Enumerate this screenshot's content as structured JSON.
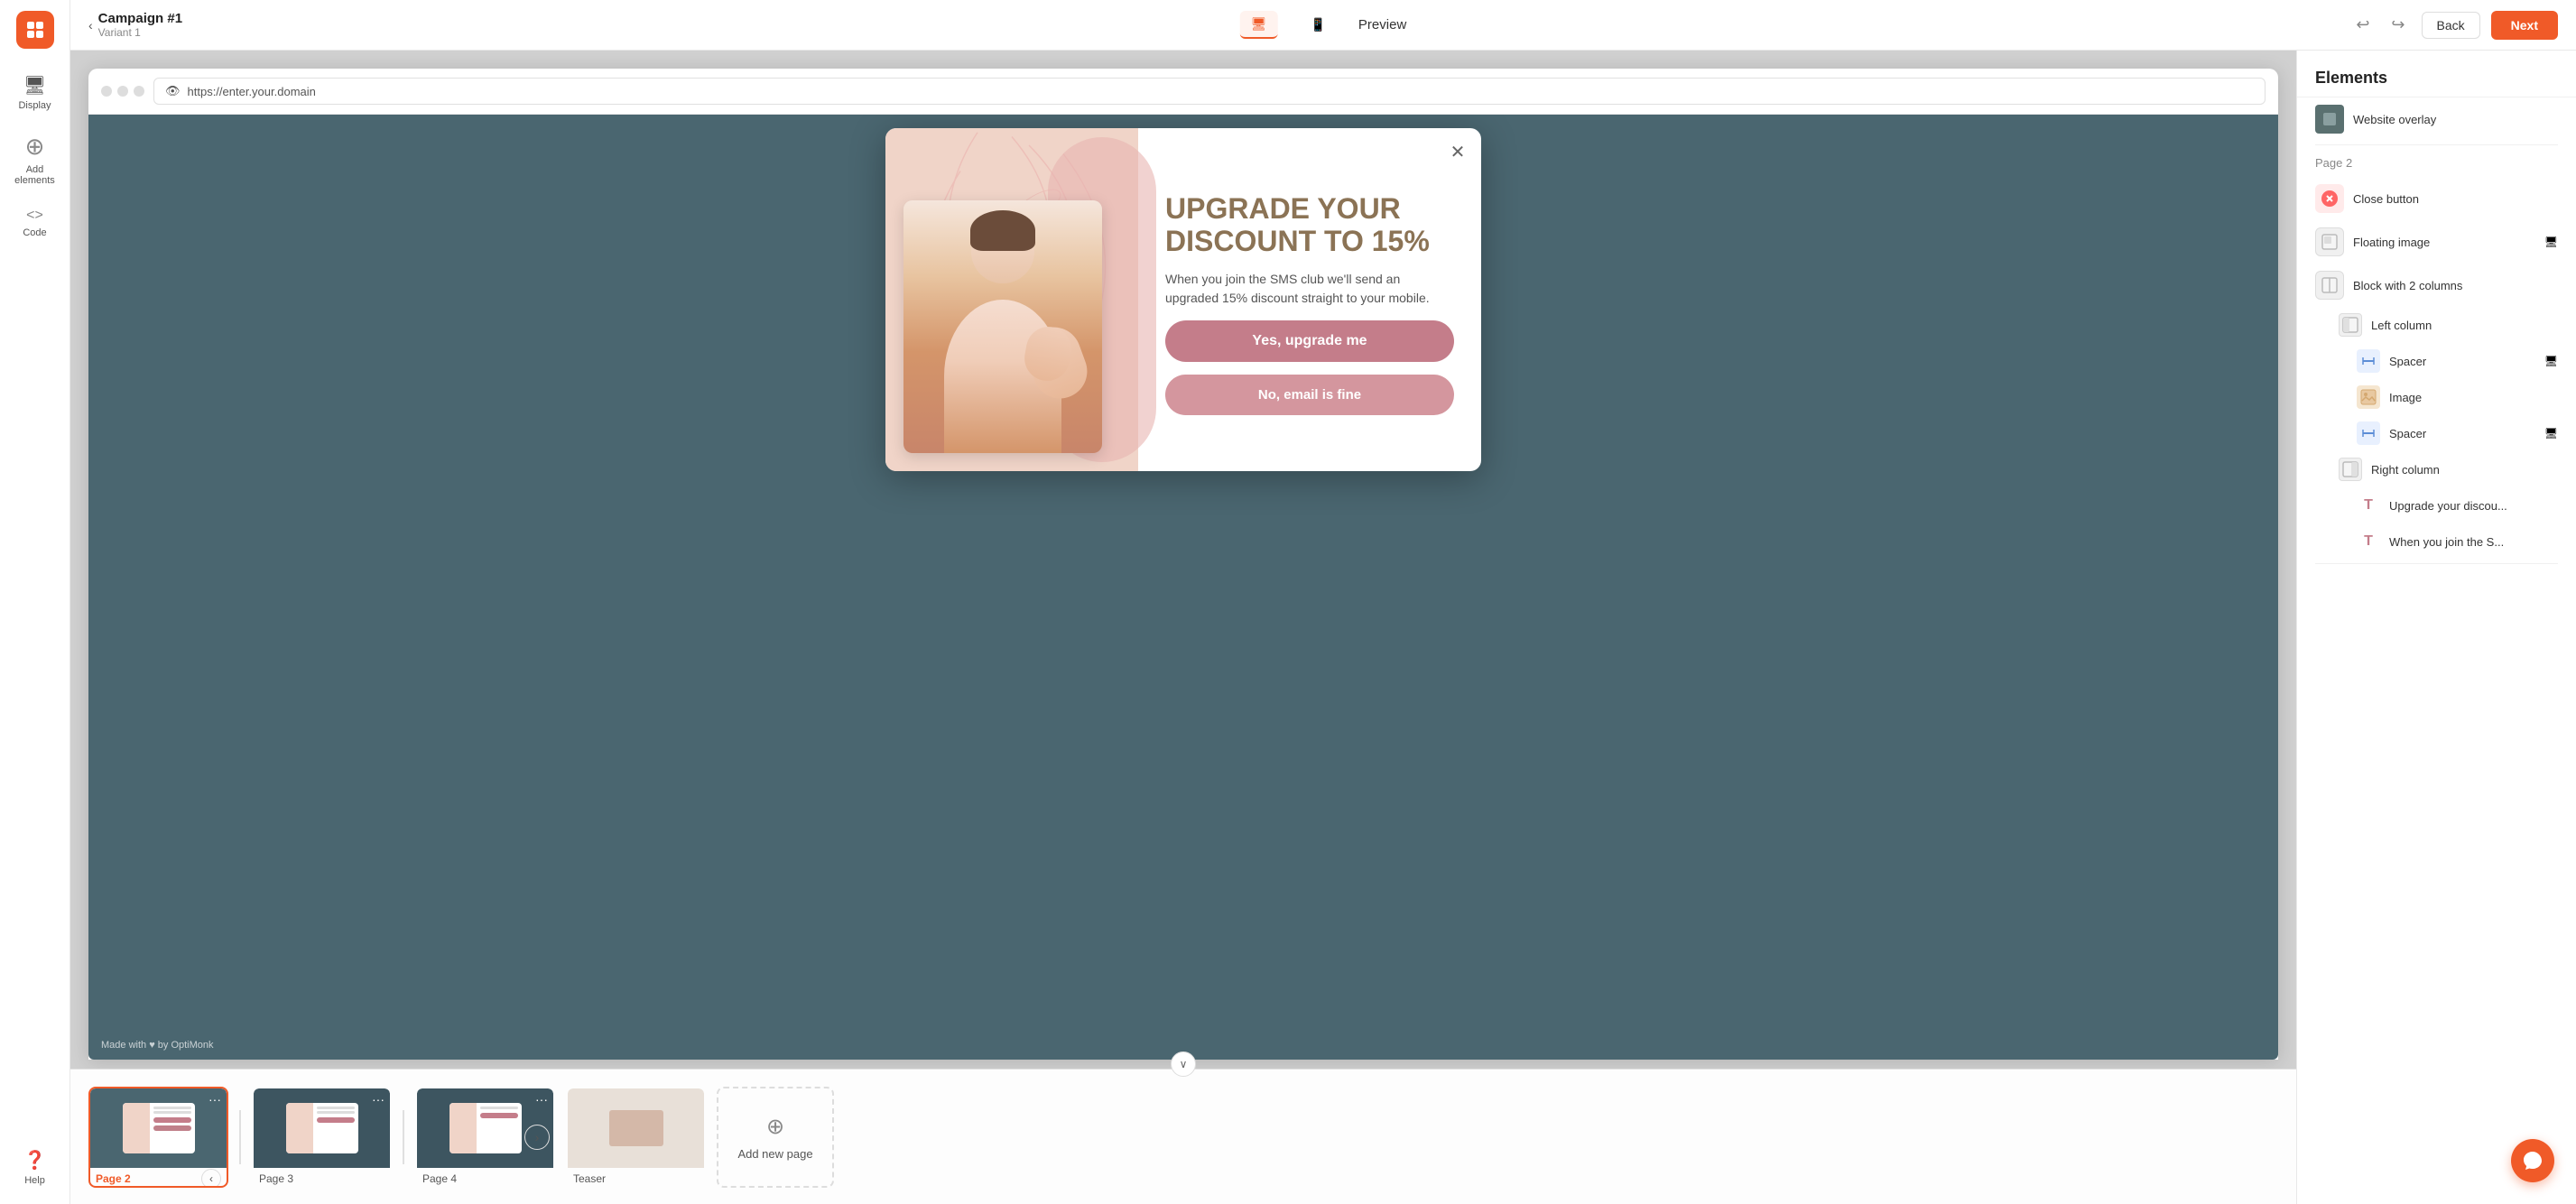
{
  "app": {
    "logo_alt": "OptiMonk logo"
  },
  "header": {
    "back_label": "Back",
    "next_label": "Next",
    "campaign_title": "Campaign #1",
    "campaign_variant": "Variant 1",
    "preview_label": "Preview",
    "url": "https://enter.your.domain",
    "device_desktop_label": "Desktop",
    "device_mobile_label": "Mobile"
  },
  "sidebar": {
    "items": [
      {
        "id": "display",
        "label": "Display",
        "icon": "🖥"
      },
      {
        "id": "add-elements",
        "label": "Add elements",
        "icon": "+"
      },
      {
        "id": "code",
        "label": "Code",
        "icon": "<>"
      },
      {
        "id": "help",
        "label": "Help",
        "icon": "?"
      }
    ]
  },
  "popup": {
    "heading": "UPGRADE YOUR DISCOUNT TO 15%",
    "body": "When you join the SMS club we'll send an upgraded 15% discount straight to your mobile.",
    "btn_yes": "Yes, upgrade me",
    "btn_no": "No, email is fine",
    "watermark": "Made with ♥ by OptiMonk"
  },
  "pages": {
    "page2_label": "Page 2",
    "page3_label": "Page 3",
    "page4_label": "Page 4",
    "teaser_label": "Teaser",
    "add_page_label": "Add new page"
  },
  "right_panel": {
    "title": "Elements",
    "page2_section": "Page 2",
    "items": [
      {
        "id": "website-overlay",
        "label": "Website overlay",
        "type": "overlay"
      },
      {
        "id": "close-button",
        "label": "Close button",
        "type": "close"
      },
      {
        "id": "floating-image",
        "label": "Floating image",
        "type": "float",
        "has_device": true
      },
      {
        "id": "block-2col",
        "label": "Block with 2 columns",
        "type": "block"
      },
      {
        "id": "left-column",
        "label": "Left column",
        "type": "col",
        "indent": true
      },
      {
        "id": "spacer-1",
        "label": "Spacer",
        "type": "spacer",
        "indent": true,
        "has_device": true
      },
      {
        "id": "image",
        "label": "Image",
        "type": "image",
        "indent": true
      },
      {
        "id": "spacer-2",
        "label": "Spacer",
        "type": "spacer",
        "indent": true,
        "has_device": true
      },
      {
        "id": "right-column",
        "label": "Right column",
        "type": "col",
        "indent": true
      },
      {
        "id": "upgrade-text",
        "label": "Upgrade your discou...",
        "type": "text",
        "indent": true
      },
      {
        "id": "when-text",
        "label": "When you join the S...",
        "type": "text",
        "indent": true
      }
    ]
  }
}
